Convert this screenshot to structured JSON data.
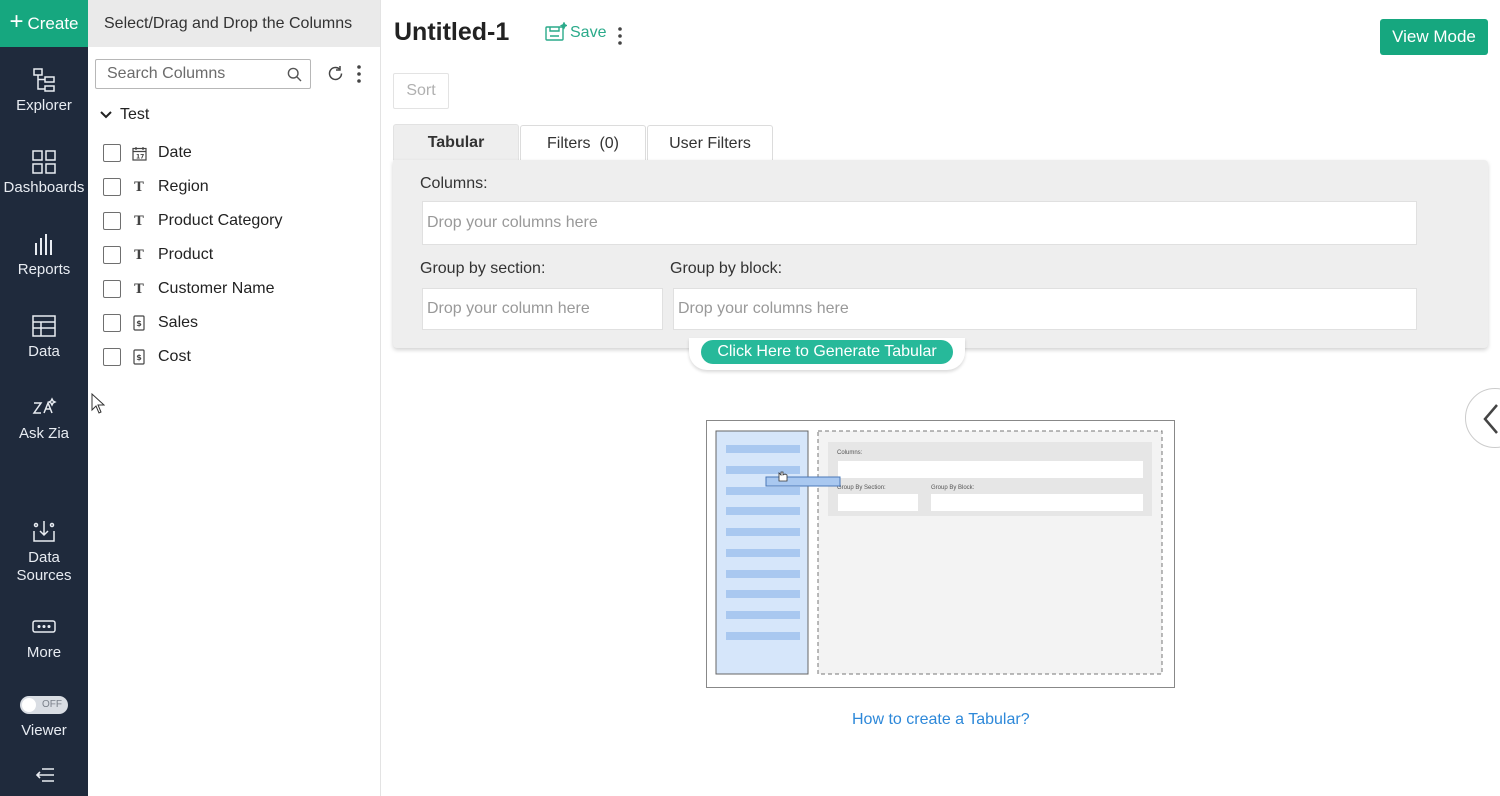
{
  "nav": {
    "create_label": "Create",
    "items": [
      {
        "label": "Explorer",
        "icon": "explorer-icon"
      },
      {
        "label": "Dashboards",
        "icon": "dashboards-icon"
      },
      {
        "label": "Reports",
        "icon": "reports-icon"
      },
      {
        "label": "Data",
        "icon": "data-icon"
      },
      {
        "label": "Ask Zia",
        "icon": "ask-zia-icon"
      },
      {
        "label": "Data Sources",
        "icon": "data-sources-icon"
      },
      {
        "label": "More",
        "icon": "more-icon"
      }
    ],
    "viewer_toggle_text": "OFF",
    "viewer_label": "Viewer",
    "colors": {
      "background": "#1f2a3c",
      "accent": "#16a77f"
    }
  },
  "columns_panel": {
    "header": "Select/Drag and Drop the Columns",
    "search_placeholder": "Search Columns",
    "table_name": "Test",
    "columns": [
      {
        "name": "Date",
        "type": "date",
        "icon": "calendar-icon"
      },
      {
        "name": "Region",
        "type": "text",
        "icon": "text-type-icon"
      },
      {
        "name": "Product Category",
        "type": "text",
        "icon": "text-type-icon"
      },
      {
        "name": "Product",
        "type": "text",
        "icon": "text-type-icon"
      },
      {
        "name": "Customer Name",
        "type": "text",
        "icon": "text-type-icon"
      },
      {
        "name": "Sales",
        "type": "currency",
        "icon": "currency-icon"
      },
      {
        "name": "Cost",
        "type": "currency",
        "icon": "currency-icon"
      }
    ]
  },
  "main": {
    "title": "Untitled-1",
    "save_label": "Save",
    "view_mode_label": "View Mode",
    "sort_label": "Sort",
    "tabs": [
      {
        "label": "Tabular",
        "active": true
      },
      {
        "label": "Filters  (0)",
        "active": false
      },
      {
        "label": "User Filters",
        "active": false
      }
    ],
    "design": {
      "columns_label": "Columns:",
      "columns_placeholder": "Drop your columns here",
      "group_section_label": "Group by section:",
      "group_section_placeholder": "Drop your column here",
      "group_block_label": "Group by block:",
      "group_block_placeholder": "Drop your columns here"
    },
    "generate_label": "Click Here to Generate Tabular",
    "illustration": {
      "columns_label": "Columns:",
      "group_section_label": "Group By Section:",
      "group_block_label": "Group By Block:"
    },
    "help_link": "How to create a Tabular?",
    "colors": {
      "accent": "#16a77f",
      "link": "#2d88d9",
      "save": "#2aaa8a"
    }
  }
}
